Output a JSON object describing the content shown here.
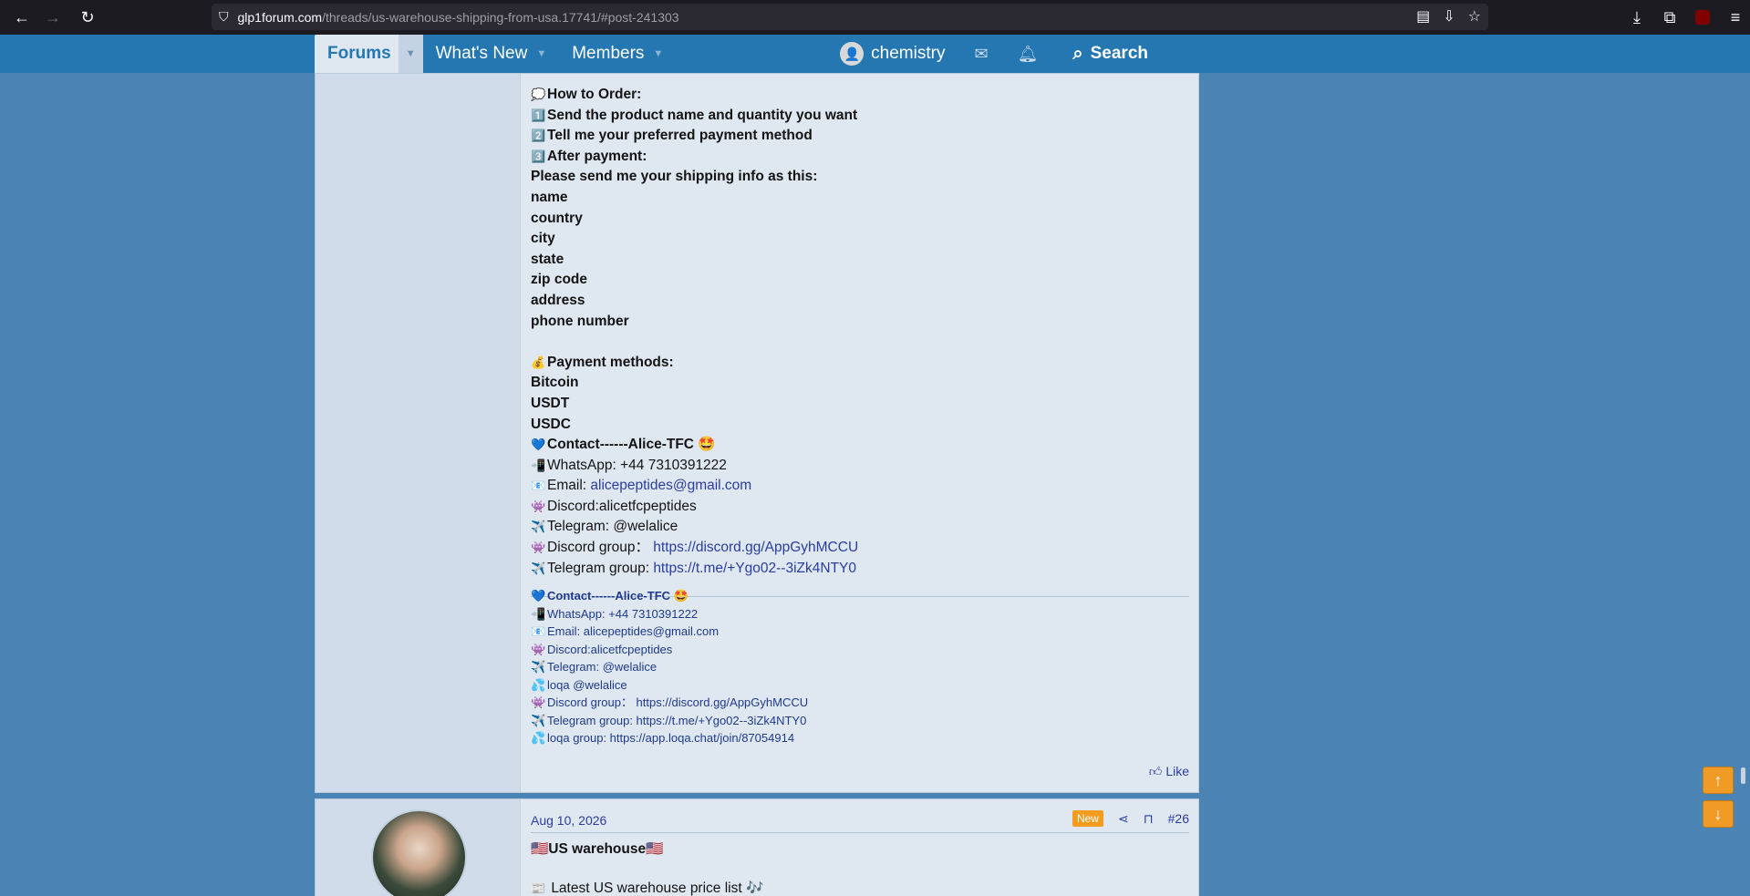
{
  "browser": {
    "url_host": "glp1forum.com",
    "url_path": "/threads/us-warehouse-shipping-from-usa.17741/#post-241303",
    "nav_back_icon": "arrow-left-icon",
    "nav_forward_icon": "arrow-right-icon",
    "reload_icon": "reload-icon"
  },
  "forum_nav": {
    "tabs": [
      {
        "label": "Forums"
      },
      {
        "label": "What's New"
      },
      {
        "label": "Members"
      }
    ],
    "username": "chemistry",
    "search_label": "Search"
  },
  "post1": {
    "lines": [
      {
        "emoji": "💭",
        "text": "How to Order:"
      },
      {
        "emoji": "1️⃣",
        "text": "Send the product name and quantity you want"
      },
      {
        "emoji": "2️⃣",
        "text": "Tell me your preferred payment method"
      },
      {
        "emoji": "3️⃣",
        "text": "After payment:"
      },
      {
        "emoji": "",
        "text": "Please send me your shipping info as this:"
      },
      {
        "emoji": "",
        "text": "name"
      },
      {
        "emoji": "",
        "text": "country"
      },
      {
        "emoji": "",
        "text": "city"
      },
      {
        "emoji": "",
        "text": "state"
      },
      {
        "emoji": "",
        "text": "zip code"
      },
      {
        "emoji": "",
        "text": "address"
      },
      {
        "emoji": "",
        "text": "phone number"
      },
      {
        "emoji": "",
        "text": ""
      },
      {
        "emoji": "💰",
        "text": "Payment methods:"
      },
      {
        "emoji": "",
        "text": "Bitcoin"
      },
      {
        "emoji": "",
        "text": "USDT"
      },
      {
        "emoji": "",
        "text": "USDC"
      },
      {
        "emoji": "💙",
        "text": "Contact------Alice-TFC 🤩"
      }
    ],
    "contacts": [
      {
        "emoji": "📲",
        "label": "WhatsApp: +44 7310391222",
        "link": ""
      },
      {
        "emoji": "📧",
        "label": "Email: ",
        "link": "alicepeptides@gmail.com"
      },
      {
        "emoji": "👾",
        "label": "Discord:alicetfcpeptides",
        "link": ""
      },
      {
        "emoji": "✈️",
        "label": "Telegram: @welalice",
        "link": ""
      },
      {
        "emoji": "👾",
        "label": "Discord group： ",
        "link": "https://discord.gg/AppGyhMCCU"
      },
      {
        "emoji": "✈️",
        "label": "Telegram group: ",
        "link": "https://t.me/+Ygo02--3iZk4NTY0"
      }
    ],
    "signature": [
      {
        "emoji": "💙",
        "text": "Contact------Alice-TFC 🤩",
        "strong": true
      },
      {
        "emoji": "📲",
        "text": "WhatsApp: +44 7310391222",
        "strong": false
      },
      {
        "emoji": "📧",
        "text": "Email: alicepeptides@gmail.com",
        "strong": false
      },
      {
        "emoji": "👾",
        "text": "Discord:alicetfcpeptides",
        "strong": false
      },
      {
        "emoji": "✈️",
        "text": "Telegram: @welalice",
        "strong": false
      },
      {
        "emoji": "💦",
        "text": "loqa @welalice",
        "strong": false
      },
      {
        "emoji": "👾",
        "text": "Discord group： https://discord.gg/AppGyhMCCU",
        "strong": false
      },
      {
        "emoji": "✈️",
        "text": "Telegram group: https://t.me/+Ygo02--3iZk4NTY0",
        "strong": false
      },
      {
        "emoji": "💦",
        "text": "loqa group: https://app.loqa.chat/join/87054914",
        "strong": false
      }
    ],
    "like_label": "Like"
  },
  "post2": {
    "date": "Aug 10, 2026",
    "new_badge": "New",
    "post_number": "#26",
    "title": "🇺🇸US warehouse🇺🇸",
    "first_line": "Latest US warehouse price list 🎶",
    "first_line_emoji": "📰"
  },
  "colors": {
    "page_bg": "#4a84b5",
    "nav_bg": "#2577b1",
    "post_bg": "#dfe7f0",
    "user_col_bg": "#d0dcea",
    "link": "#2b3d9e",
    "badge_new": "#f39c1f",
    "scroll_btn": "#f09b25"
  }
}
